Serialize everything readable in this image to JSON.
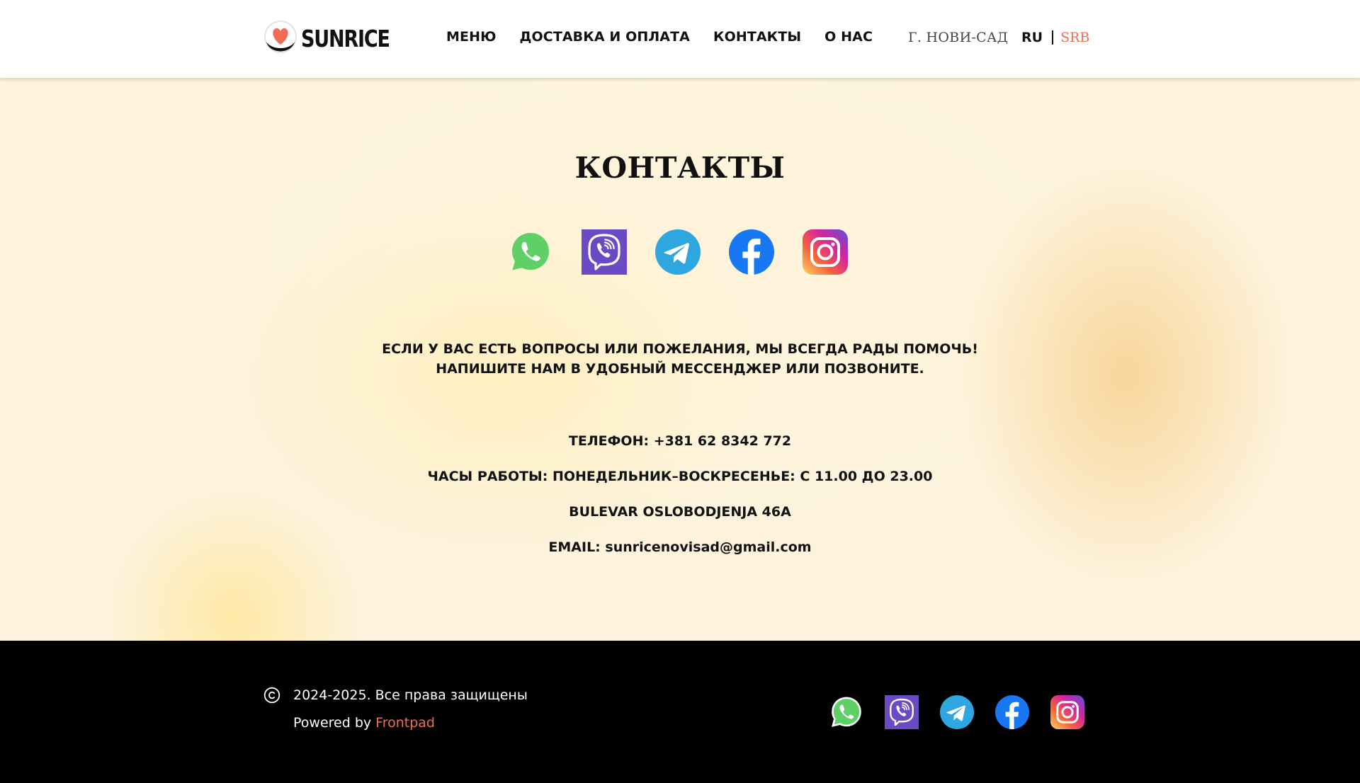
{
  "header": {
    "logo_text": "SUNRICE",
    "nav": [
      "МЕНЮ",
      "ДОСТАВКА И ОПЛАТА",
      "КОНТАКТЫ",
      "О НАС"
    ],
    "city": "Г. НОВИ-САД",
    "lang_active": "RU",
    "lang_alt": "SRB"
  },
  "contacts": {
    "title": "КОНТАКТЫ",
    "socials": [
      "whatsapp-icon",
      "viber-icon",
      "telegram-icon",
      "facebook-icon",
      "instagram-icon"
    ],
    "intro_line1": "ЕСЛИ У ВАС ЕСТЬ ВОПРОСЫ ИЛИ ПОЖЕЛАНИЯ, МЫ ВСЕГДА РАДЫ ПОМОЧЬ!",
    "intro_line2": "НАПИШИТЕ НАМ В УДОБНЫЙ МЕССЕНДЖЕР ИЛИ ПОЗВОНИТЕ.",
    "phone": "ТЕЛЕФОН: +381 62 8342 772",
    "hours": "ЧАСЫ РАБОТЫ: ПОНЕДЕЛЬНИК–ВОСКРЕСЕНЬЕ: С 11.00 ДО 23.00",
    "address": "BULEVAR OSLOBODJENJA 46A",
    "email": "EMAIL: sunricenovisad@gmail.com"
  },
  "footer": {
    "copyright": "2024-2025. Все права защищены",
    "powered_prefix": "Powered by ",
    "powered_link": "Frontpad"
  },
  "colors": {
    "accent": "#ef6d55",
    "whatsapp": "#5fd068",
    "viber": "#6a4bc4",
    "telegram": "#2ea6df",
    "facebook": "#1877f2",
    "footer_bg": "#000000"
  }
}
